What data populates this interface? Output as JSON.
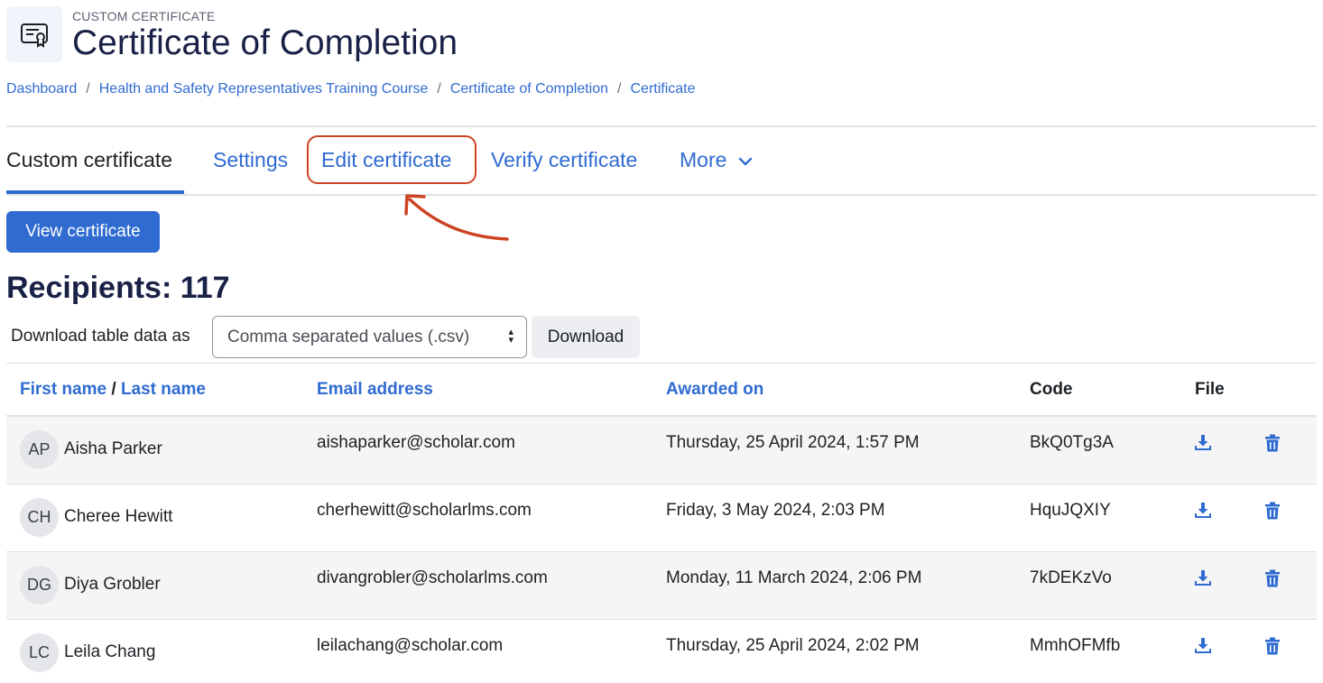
{
  "header": {
    "kicker": "CUSTOM CERTIFICATE",
    "title": "Certificate of Completion",
    "icon": "certificate-icon"
  },
  "breadcrumb": [
    "Dashboard",
    "Health and Safety Representatives Training Course",
    "Certificate of Completion",
    "Certificate"
  ],
  "tabs": {
    "custom_certificate": "Custom certificate",
    "settings": "Settings",
    "edit_certificate": "Edit certificate",
    "verify_certificate": "Verify certificate",
    "more": "More"
  },
  "view_certificate_button": "View certificate",
  "recipients_heading": "Recipients: 117",
  "download": {
    "label": "Download table data as",
    "selected_format": "Comma separated values (.csv)",
    "button": "Download"
  },
  "table": {
    "headers": {
      "first_name": "First name",
      "name_sep": "/",
      "last_name": "Last name",
      "email": "Email address",
      "awarded_on": "Awarded on",
      "code": "Code",
      "file": "File"
    },
    "rows": [
      {
        "initials": "AP",
        "name": "Aisha Parker",
        "email": "aishaparker@scholar.com",
        "awarded": "Thursday, 25 April 2024, 1:57 PM",
        "code": "BkQ0Tg3A"
      },
      {
        "initials": "CH",
        "name": "Cheree Hewitt",
        "email": "cherhewitt@scholarlms.com",
        "awarded": "Friday, 3 May 2024, 2:03 PM",
        "code": "HquJQXIY"
      },
      {
        "initials": "DG",
        "name": "Diya Grobler",
        "email": "divangrobler@scholarlms.com",
        "awarded": "Monday, 11 March 2024, 2:06 PM",
        "code": "7kDEKzVo"
      },
      {
        "initials": "LC",
        "name": "Leila Chang",
        "email": "leilachang@scholar.com",
        "awarded": "Thursday, 25 April 2024, 2:02 PM",
        "code": "MmhOFMfb"
      }
    ]
  },
  "colors": {
    "link": "#2f6bd1",
    "title": "#1a2147",
    "annotation": "#cd4322"
  }
}
